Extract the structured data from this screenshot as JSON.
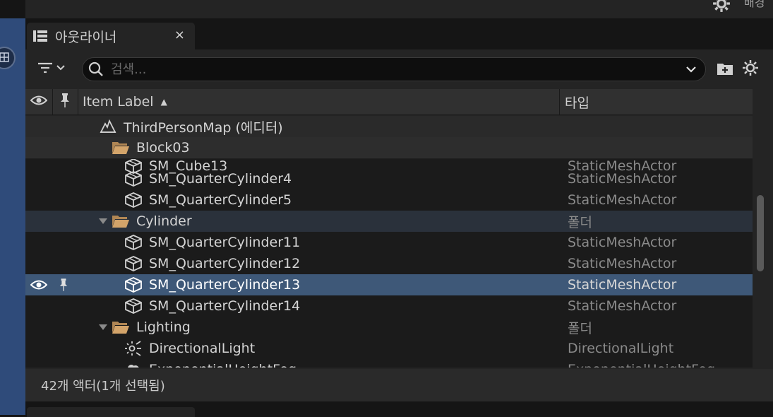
{
  "top_bar": {
    "partial_text": "배경",
    "gear_icon": "gear-icon"
  },
  "tab": {
    "label": "아웃라이너",
    "close": "×"
  },
  "search": {
    "placeholder": "검색..."
  },
  "columns": {
    "visibility": "eye-icon",
    "pin": "pin-icon",
    "label": "Item Label",
    "type": "타입"
  },
  "rows": [
    {
      "label": "ThirdPersonMap (에디터)",
      "type": "",
      "icon": "map-icon"
    },
    {
      "label": "Block03",
      "type": "",
      "icon": "folder-open-icon"
    },
    {
      "label": "SM_Cube13",
      "type": "StaticMeshActor",
      "icon": "static-mesh-icon"
    },
    {
      "label": "SM_QuarterCylinder4",
      "type": "StaticMeshActor",
      "icon": "static-mesh-icon"
    },
    {
      "label": "SM_QuarterCylinder5",
      "type": "StaticMeshActor",
      "icon": "static-mesh-icon"
    },
    {
      "label": "Cylinder",
      "type": "폴더",
      "icon": "folder-open-icon",
      "expanded": true
    },
    {
      "label": "SM_QuarterCylinder11",
      "type": "StaticMeshActor",
      "icon": "static-mesh-icon"
    },
    {
      "label": "SM_QuarterCylinder12",
      "type": "StaticMeshActor",
      "icon": "static-mesh-icon"
    },
    {
      "label": "SM_QuarterCylinder13",
      "type": "StaticMeshActor",
      "icon": "static-mesh-icon",
      "selected": true
    },
    {
      "label": "SM_QuarterCylinder14",
      "type": "StaticMeshActor",
      "icon": "static-mesh-icon"
    },
    {
      "label": "Lighting",
      "type": "폴더",
      "icon": "folder-open-icon",
      "expanded": true
    },
    {
      "label": "DirectionalLight",
      "type": "DirectionalLight",
      "icon": "directional-light-icon"
    },
    {
      "label": "ExponentialHeightFog",
      "type": "ExponentialHeightFog",
      "icon": "fog-icon"
    }
  ],
  "status": {
    "text": "42개 액터(1개 선택됨)"
  },
  "colors": {
    "selected_row": "#3e5878",
    "panel_bg": "#242424",
    "left_strip": "#2f4b7a"
  }
}
